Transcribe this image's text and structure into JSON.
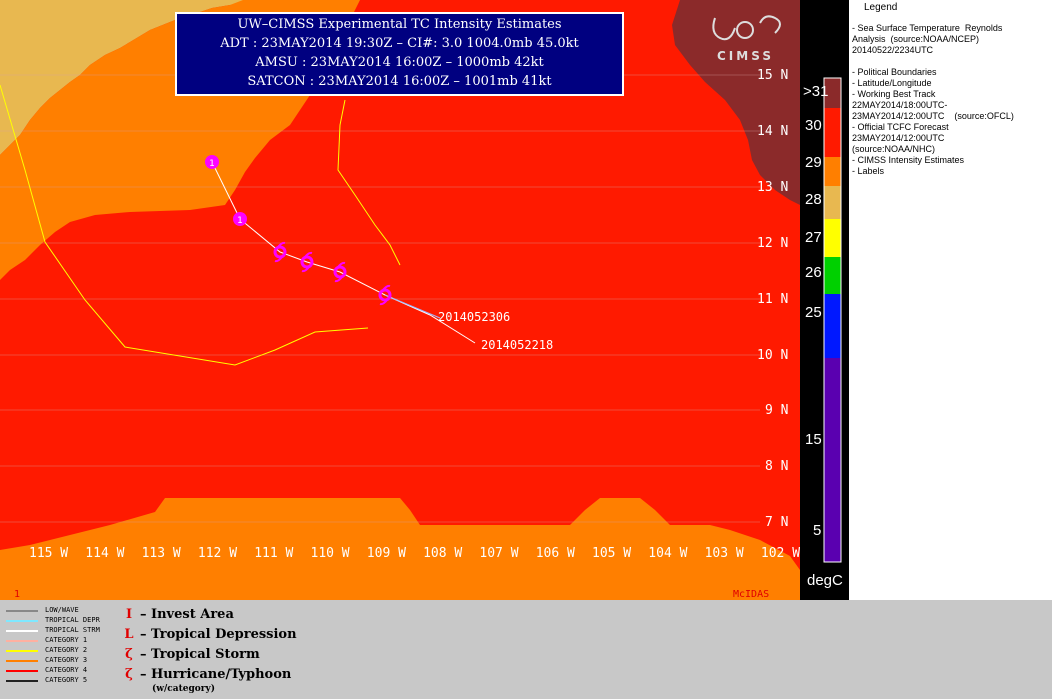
{
  "title_box": {
    "line1": "UW–CIMSS Experimental TC Intensity Estimates",
    "line2": "ADT : 23MAY2014 19:30Z –  CI#: 3.0  1004.0mb  45.0kt",
    "line3": "AMSU : 23MAY2014 16:00Z –  1000mb  42kt",
    "line4": "SATCON : 23MAY2014 16:00Z –  1001mb  41kt"
  },
  "logo": {
    "text": "CIMSS"
  },
  "lat_labels": [
    "15 N",
    "14 N",
    "13 N",
    "12 N",
    "11 N",
    "10 N",
    "9 N",
    "8 N",
    "7 N"
  ],
  "lon_labels": [
    "115 W",
    "114 W",
    "113 W",
    "112 W",
    "111 W",
    "110 W",
    "109 W",
    "108 W",
    "107 W",
    "106 W",
    "105 W",
    "104 W",
    "103 W",
    "102 W"
  ],
  "frame_number": "1",
  "mcidas_label": "McIDAS",
  "track_labels": {
    "first": "2014052306",
    "second": "2014052218"
  },
  "storm_markers": [
    {
      "type": "invest",
      "symbol": "1"
    },
    {
      "type": "invest",
      "symbol": "1"
    },
    {
      "type": "tropical-storm",
      "symbol": "S"
    },
    {
      "type": "tropical-storm",
      "symbol": "S"
    },
    {
      "type": "tropical-storm",
      "symbol": "S"
    },
    {
      "type": "tropical-storm",
      "symbol": "S"
    }
  ],
  "color_scale": {
    "labels": [
      ">31",
      "30",
      "29",
      "28",
      "27",
      "26",
      "25",
      "15",
      "5"
    ],
    "unit": "degC",
    "colors": {
      "gt31": "#8b2a2a",
      "c30": "#ff1a00",
      "c29": "#ff7f00",
      "c28": "#e8b850",
      "c27": "#ffff00",
      "c26": "#00d000",
      "c25": "#0018ff",
      "cold": "#5a00b0"
    }
  },
  "legend": {
    "heading": "Legend",
    "lines": [
      "- Sea Surface Temperature  Reynolds",
      "Analysis  (source:NOAA/NCEP)",
      "20140522/2234UTC",
      "",
      "- Political Boundaries",
      "- Latitude/Longitude",
      "- Working Best Track",
      "22MAY2014/18:00UTC-",
      "23MAY2014/12:00UTC    (source:OFCL)",
      "- Official TCFC Forecast",
      "23MAY2014/12:00UTC",
      "(source:NOAA/NHC)",
      "- CIMSS Intensity Estimates",
      "- Labels"
    ]
  },
  "track_legend": [
    {
      "label": "LOW/WAVE",
      "color": "#888888"
    },
    {
      "label": "TROPICAL DEPR",
      "color": "#7fe8ff"
    },
    {
      "label": "TROPICAL STRM",
      "color": "#ffffff"
    },
    {
      "label": "CATEGORY 1",
      "color": "#ffb0a0"
    },
    {
      "label": "CATEGORY 2",
      "color": "#ffff00"
    },
    {
      "label": "CATEGORY 3",
      "color": "#ff8000"
    },
    {
      "label": "CATEGORY 4",
      "color": "#ff0000"
    },
    {
      "label": "CATEGORY 5",
      "color": "#222222"
    }
  ],
  "symbol_legend": [
    {
      "symbol": "I",
      "label": "– Invest Area"
    },
    {
      "symbol": "L",
      "label": "– Tropical Depression"
    },
    {
      "symbol": "ζ",
      "label": "– Tropical Storm"
    },
    {
      "symbol": "ζ",
      "label": "– Hurricane/Typhoon"
    }
  ],
  "symbol_legend_note": "(w/category)"
}
